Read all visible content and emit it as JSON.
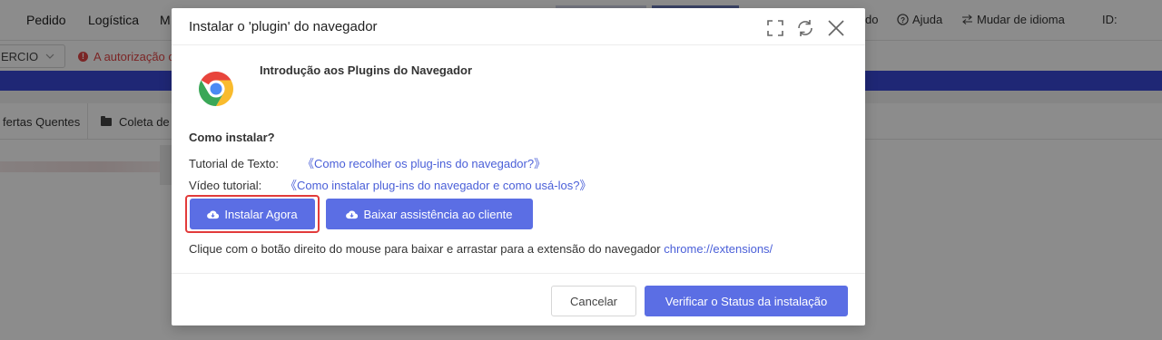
{
  "background": {
    "nav": [
      "Pedido",
      "Logística",
      "M"
    ],
    "right_nav": {
      "partial": "do",
      "help": "Ajuda",
      "language": "Mudar de idioma",
      "id_label": "ID:"
    },
    "select_value": "ERCIO",
    "warning_text": "A autorização c",
    "tabs": [
      "fertas Quentes",
      "Coleta de"
    ]
  },
  "modal": {
    "title": "Instalar o 'plugin' do navegador",
    "intro_title": "Introdução aos Plugins do Navegador",
    "how_to": "Como instalar?",
    "text_tutorial_label": "Tutorial de Texto:",
    "text_tutorial_link": "《Como recolher os plug-ins do navegador?》",
    "video_tutorial_label": "Vídeo tutorial:",
    "video_tutorial_link": "《Como instalar plug-ins do navegador e como usá-los?》",
    "install_button": "Instalar Agora",
    "download_button": "Baixar assistência ao cliente",
    "note_text": "Clique com o botão direito do mouse para baixar e arrastar para a extensão do navegador ",
    "note_link": "chrome://extensions/",
    "cancel_button": "Cancelar",
    "verify_button": "Verificar o Status da instalação"
  },
  "icons": [
    "fullscreen-icon",
    "refresh-icon",
    "close-icon",
    "chrome-logo",
    "cloud-download-icon",
    "help-icon",
    "language-switch-icon",
    "folder-icon",
    "warning-icon",
    "chevron-down-icon"
  ],
  "colors": {
    "primary": "#5b6ee4",
    "link": "#4a5fd8",
    "highlight": "#e23b3b",
    "warning": "#e04545"
  }
}
